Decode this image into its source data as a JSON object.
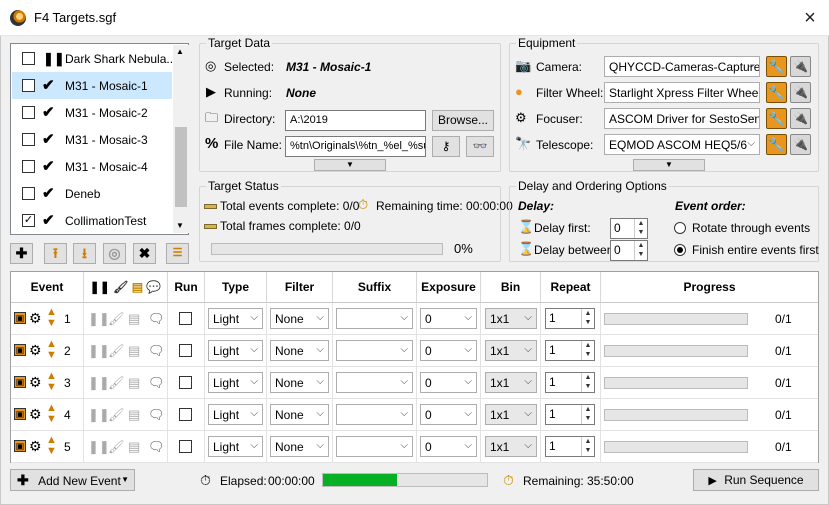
{
  "window": {
    "title": "F4 Targets.sgf",
    "close_icon": "×"
  },
  "targets": [
    {
      "name": "Dark Shark Nebula...",
      "checked": false,
      "status": "paused",
      "selected": false
    },
    {
      "name": "M31 - Mosaic-1",
      "checked": false,
      "status": "done",
      "selected": true
    },
    {
      "name": "M31 - Mosaic-2",
      "checked": false,
      "status": "done",
      "selected": false
    },
    {
      "name": "M31 - Mosaic-3",
      "checked": false,
      "status": "done",
      "selected": false
    },
    {
      "name": "M31 - Mosaic-4",
      "checked": false,
      "status": "done",
      "selected": false
    },
    {
      "name": "Deneb",
      "checked": false,
      "status": "done",
      "selected": false
    },
    {
      "name": "CollimationTest",
      "checked": true,
      "status": "done",
      "selected": false
    }
  ],
  "target_data": {
    "group_label": "Target Data",
    "selected_label": "Selected:",
    "selected_value": "M31 - Mosaic-1",
    "running_label": "Running:",
    "running_value": "None",
    "directory_label": "Directory:",
    "directory_value": "A:\\2019",
    "browse_label": "Browse...",
    "filename_label": "File Name:",
    "filename_value": "%tn\\Originals\\%tn_%el_%su_"
  },
  "equipment": {
    "group_label": "Equipment",
    "items": [
      {
        "label": "Camera:",
        "value": "QHYCCD-Cameras-Capture"
      },
      {
        "label": "Filter Wheel:",
        "value": "Starlight Xpress Filter Wheel"
      },
      {
        "label": "Focuser:",
        "value": "ASCOM Driver for SestoSenso"
      },
      {
        "label": "Telescope:",
        "value": "EQMOD ASCOM HEQ5/6"
      }
    ]
  },
  "target_status": {
    "group_label": "Target Status",
    "events_complete": "Total events complete: 0/0",
    "remaining_time": "Remaining time: 00:00:00",
    "frames_complete": "Total frames complete: 0/0",
    "progress_pct": "0%",
    "progress_value": 0
  },
  "delay": {
    "group_label": "Delay and Ordering Options",
    "delay_title": "Delay:",
    "delay_first_label": "Delay first:",
    "delay_first_value": "0",
    "delay_between_label": "Delay between:",
    "delay_between_value": "0",
    "event_order_title": "Event order:",
    "option_rotate": "Rotate through events",
    "option_finish": "Finish entire events first",
    "selected_option": "finish"
  },
  "events_table": {
    "headers": {
      "event": "Event",
      "run": "Run",
      "type": "Type",
      "filter": "Filter",
      "suffix": "Suffix",
      "exposure": "Exposure",
      "bin": "Bin",
      "repeat": "Repeat",
      "progress": "Progress"
    },
    "rows": [
      {
        "num": "1",
        "type": "Light",
        "filter": "None",
        "suffix": "",
        "exposure": "0",
        "bin": "1x1",
        "repeat": "1",
        "progress": "0/1"
      },
      {
        "num": "2",
        "type": "Light",
        "filter": "None",
        "suffix": "",
        "exposure": "0",
        "bin": "1x1",
        "repeat": "1",
        "progress": "0/1"
      },
      {
        "num": "3",
        "type": "Light",
        "filter": "None",
        "suffix": "",
        "exposure": "0",
        "bin": "1x1",
        "repeat": "1",
        "progress": "0/1"
      },
      {
        "num": "4",
        "type": "Light",
        "filter": "None",
        "suffix": "",
        "exposure": "0",
        "bin": "1x1",
        "repeat": "1",
        "progress": "0/1"
      },
      {
        "num": "5",
        "type": "Light",
        "filter": "None",
        "suffix": "",
        "exposure": "0",
        "bin": "1x1",
        "repeat": "1",
        "progress": "0/1"
      }
    ]
  },
  "bottom": {
    "add_event_label": "Add New Event",
    "elapsed_label": "Elapsed:",
    "elapsed_value": "00:00:00",
    "elapsed_progress": 0.45,
    "remaining_label": "Remaining:",
    "remaining_value": "35:50:00",
    "run_label": "Run Sequence"
  },
  "colors": {
    "accent": "#e8961e",
    "selection": "#cce8ff",
    "progress_green": "#06b025"
  }
}
